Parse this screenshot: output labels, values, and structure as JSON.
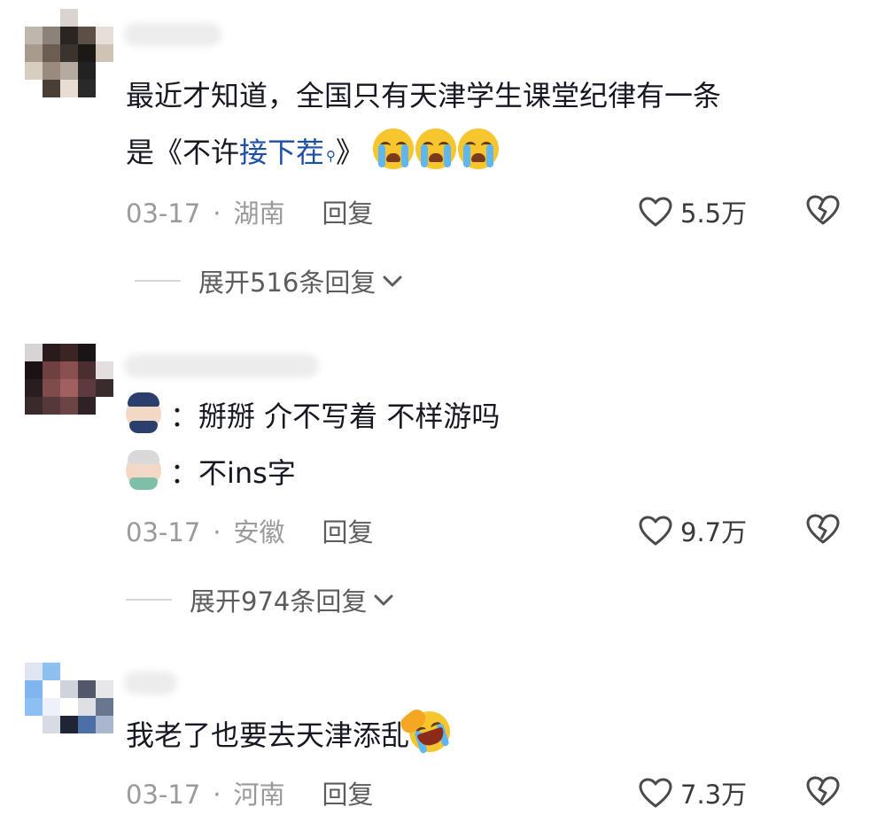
{
  "comments": [
    {
      "text_parts": [
        "最近才知道，全国只有天津学生课堂纪律有一条",
        "是《不许",
        "接下茬",
        "》"
      ],
      "link_marker": "search-icon",
      "emoji": "loudly-crying-face",
      "date": "03-17",
      "location": "湖南",
      "reply_label": "回复",
      "likes": "5.5万",
      "expand_label": "展开516条回复"
    },
    {
      "lines": [
        {
          "emoji": "police-officer",
          "text": "：掰掰 介不写着 不样游吗"
        },
        {
          "emoji": "old-man",
          "text": "：不ins字"
        }
      ],
      "date": "03-17",
      "location": "安徽",
      "reply_label": "回复",
      "likes": "9.7万",
      "expand_label": "展开974条回复"
    },
    {
      "text": "我老了也要去天津添乱",
      "emoji": "rolling-on-the-floor-laughing",
      "date": "03-17",
      "location": "河南",
      "reply_label": "回复",
      "likes": "7.3万"
    }
  ],
  "colors": {
    "link": "#1d4fa8",
    "meta": "#9a9a9a",
    "text": "#161823"
  }
}
